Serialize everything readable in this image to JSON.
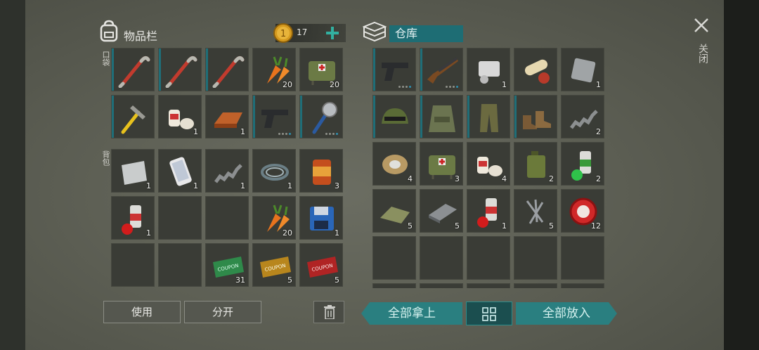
{
  "inventory": {
    "title": "物品栏",
    "coins": "17",
    "pockets_label": "口袋",
    "backpack_label": "背包",
    "pockets": [
      {
        "icon": "crowbar-icon",
        "count": "",
        "bar": true
      },
      {
        "icon": "crowbar-icon",
        "count": "",
        "bar": true
      },
      {
        "icon": "crowbar-icon",
        "count": "",
        "bar": true
      },
      {
        "icon": "carrot-icon",
        "count": "20",
        "bar": false
      },
      {
        "icon": "medkit-bag-icon",
        "count": "20",
        "bar": false
      },
      {
        "icon": "hammer-icon",
        "count": "",
        "bar": true
      },
      {
        "icon": "bandage-icon",
        "count": "1",
        "bar": false
      },
      {
        "icon": "copper-ingot-icon",
        "count": "1",
        "bar": false
      },
      {
        "icon": "pistol-icon",
        "count": "",
        "bar": true,
        "dots": true
      },
      {
        "icon": "saw-axe-icon",
        "count": "",
        "bar": true,
        "dots": true
      }
    ],
    "backpack": [
      {
        "icon": "metal-sheet-icon",
        "count": "1"
      },
      {
        "icon": "smartphone-icon",
        "count": "1"
      },
      {
        "icon": "spring-icon",
        "count": "1"
      },
      {
        "icon": "wire-icon",
        "count": "1"
      },
      {
        "icon": "canned-food-icon",
        "count": "3"
      },
      {
        "icon": "spray-can-icon",
        "count": "1"
      },
      {
        "icon": "",
        "count": ""
      },
      {
        "icon": "",
        "count": ""
      },
      {
        "icon": "carrot-icon",
        "count": "20"
      },
      {
        "icon": "floppy-disk-icon",
        "count": "1"
      },
      {
        "icon": "",
        "count": ""
      },
      {
        "icon": "",
        "count": ""
      },
      {
        "icon": "ration-coupon-icon",
        "count": "31"
      },
      {
        "icon": "combat-coupon-icon",
        "count": "5"
      },
      {
        "icon": "red-coupon-icon",
        "count": "5"
      }
    ],
    "buttons": {
      "use": "使用",
      "split": "分开"
    }
  },
  "warehouse": {
    "title": "仓库",
    "items": [
      {
        "icon": "pistol-icon",
        "count": "",
        "bar": true,
        "dots": true
      },
      {
        "icon": "shotgun-icon",
        "count": "",
        "bar": true,
        "dots": true
      },
      {
        "icon": "engine-part-icon",
        "count": "1"
      },
      {
        "icon": "pills-icon",
        "count": ""
      },
      {
        "icon": "metal-plate-icon",
        "count": "1"
      },
      {
        "icon": "military-helmet-icon",
        "count": "",
        "bar": true
      },
      {
        "icon": "tactical-vest-icon",
        "count": "",
        "bar": true
      },
      {
        "icon": "camo-pants-icon",
        "count": "",
        "bar": true
      },
      {
        "icon": "boots-icon",
        "count": "",
        "bar": true
      },
      {
        "icon": "spring-icon",
        "count": "2"
      },
      {
        "icon": "wire-spool-icon",
        "count": "4"
      },
      {
        "icon": "medkit-bag-icon",
        "count": "3"
      },
      {
        "icon": "bandage-icon",
        "count": "4"
      },
      {
        "icon": "jerrycan-icon",
        "count": "2"
      },
      {
        "icon": "spray-can-green-icon",
        "count": "2"
      },
      {
        "icon": "cloth-icon",
        "count": "5"
      },
      {
        "icon": "metal-bar-icon",
        "count": "5"
      },
      {
        "icon": "spray-can-icon",
        "count": "1"
      },
      {
        "icon": "nails-icon",
        "count": "5"
      },
      {
        "icon": "bottle-cap-icon",
        "count": "12"
      }
    ],
    "empty_rows": 2,
    "buttons": {
      "take_all": "全部拿上",
      "put_all": "全部放入"
    }
  },
  "close": {
    "label": "关闭"
  },
  "colors": {
    "accent": "#2a7f80",
    "bar": "#1f6e78",
    "slot": "#3a3c36"
  }
}
